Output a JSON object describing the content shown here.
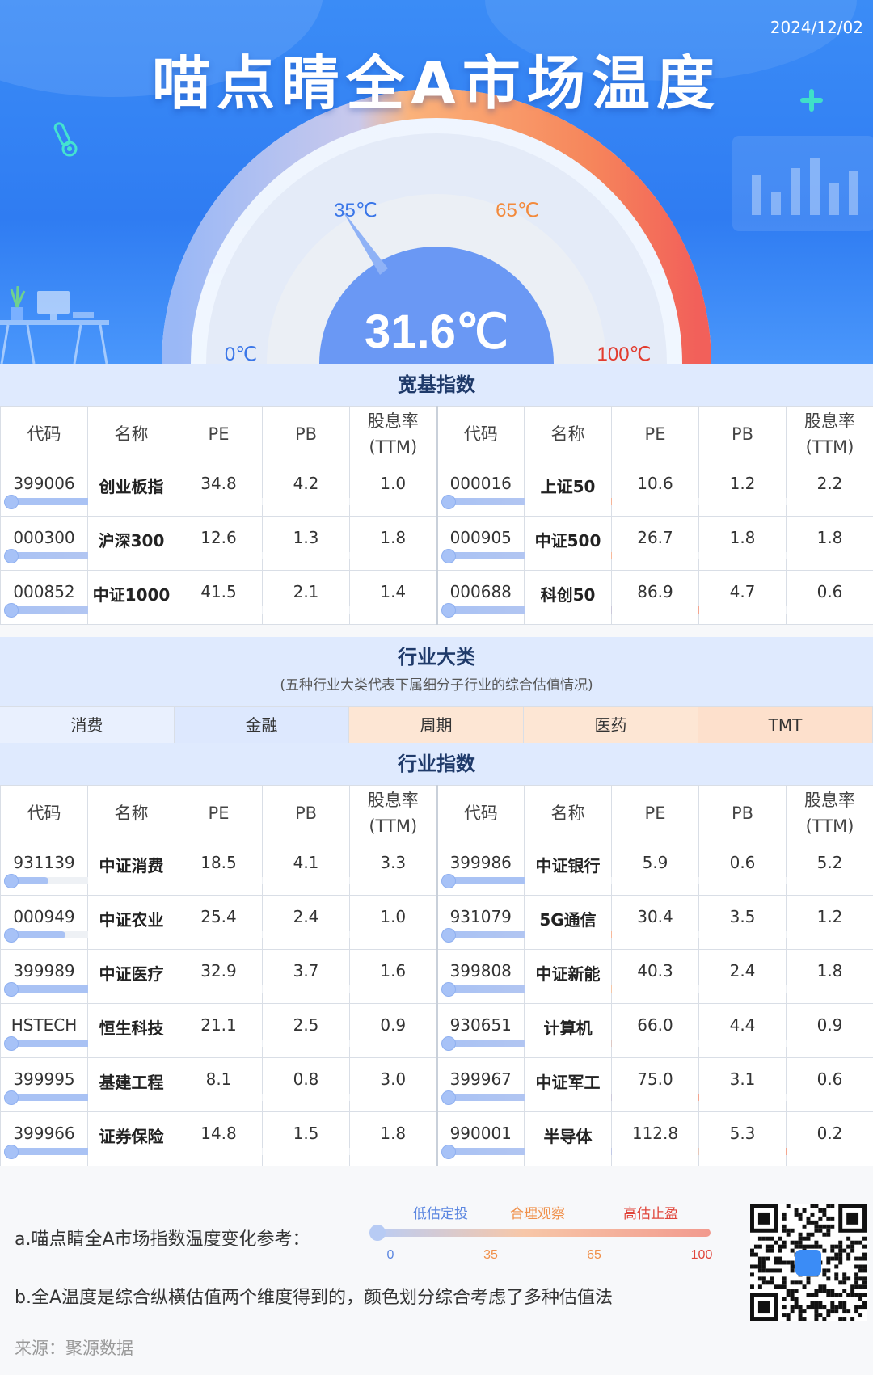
{
  "header": {
    "date": "2024/12/02",
    "title": "喵点睛全A市场温度",
    "temperature": "31.6℃",
    "temperature_value": 31.6,
    "scale_labels": {
      "zero": "0℃",
      "low": "35℃",
      "mid": "65℃",
      "high": "100℃"
    }
  },
  "broad": {
    "title": "宽基指数",
    "headers": [
      "代码",
      "名称",
      "PE",
      "PB",
      "股息率",
      "(TTM)"
    ],
    "rows": [
      [
        {
          "code": "399006",
          "name": "创业板指",
          "pe": "34.8",
          "pb": "4.2",
          "dy": "1.0",
          "level": 0.24
        },
        {
          "code": "000016",
          "name": "上证50",
          "pe": "10.6",
          "pb": "1.2",
          "dy": "2.2",
          "level": 0.43
        }
      ],
      [
        {
          "code": "000300",
          "name": "沪深300",
          "pe": "12.6",
          "pb": "1.3",
          "dy": "1.8",
          "level": 0.39
        },
        {
          "code": "000905",
          "name": "中证500",
          "pe": "26.7",
          "pb": "1.8",
          "dy": "1.8",
          "level": 0.44
        }
      ],
      [
        {
          "code": "000852",
          "name": "中证1000",
          "pe": "41.5",
          "pb": "2.1",
          "dy": "1.4",
          "level": 0.42
        },
        {
          "code": "000688",
          "name": "科创50",
          "pe": "86.9",
          "pb": "4.7",
          "dy": "0.6",
          "level": 0.62
        }
      ]
    ]
  },
  "category": {
    "title": "行业大类",
    "subtitle": "(五种行业大类代表下属细分子行业的综合估值情况)",
    "items": [
      "消费",
      "金融",
      "周期",
      "医药",
      "TMT"
    ],
    "colors": [
      "#e9f0fe",
      "#dde8fe",
      "#fde6d4",
      "#fde6d4",
      "#fde0cc"
    ]
  },
  "industry": {
    "title": "行业指数",
    "headers": [
      "代码",
      "名称",
      "PE",
      "PB",
      "股息率",
      "(TTM)"
    ],
    "rows": [
      [
        {
          "code": "931139",
          "name": "中证消费",
          "pe": "18.5",
          "pb": "4.1",
          "dy": "3.3",
          "level": 0.1
        },
        {
          "code": "399986",
          "name": "中证银行",
          "pe": "5.9",
          "pb": "0.6",
          "dy": "5.2",
          "level": 0.28
        }
      ],
      [
        {
          "code": "000949",
          "name": "中证农业",
          "pe": "25.4",
          "pb": "2.4",
          "dy": "1.0",
          "level": 0.14
        },
        {
          "code": "931079",
          "name": "5G通信",
          "pe": "30.4",
          "pb": "3.5",
          "dy": "1.2",
          "level": 0.44
        }
      ],
      [
        {
          "code": "399989",
          "name": "中证医疗",
          "pe": "32.9",
          "pb": "3.7",
          "dy": "1.6",
          "level": 0.23
        },
        {
          "code": "399808",
          "name": "中证新能",
          "pe": "40.3",
          "pb": "2.4",
          "dy": "1.8",
          "level": 0.47
        }
      ],
      [
        {
          "code": "HSTECH",
          "name": "恒生科技",
          "pe": "21.1",
          "pb": "2.5",
          "dy": "0.9",
          "level": 0.25
        },
        {
          "code": "930651",
          "name": "计算机",
          "pe": "66.0",
          "pb": "4.4",
          "dy": "0.9",
          "level": 0.52
        }
      ],
      [
        {
          "code": "399995",
          "name": "基建工程",
          "pe": "8.1",
          "pb": "0.8",
          "dy": "3.0",
          "level": 0.26
        },
        {
          "code": "399967",
          "name": "中证军工",
          "pe": "75.0",
          "pb": "3.1",
          "dy": "0.6",
          "level": 0.62
        }
      ],
      [
        {
          "code": "399966",
          "name": "证券保险",
          "pe": "14.8",
          "pb": "1.5",
          "dy": "1.8",
          "level": 0.3
        },
        {
          "code": "990001",
          "name": "半导体",
          "pe": "112.8",
          "pb": "5.3",
          "dy": "0.2",
          "level": 0.83
        }
      ]
    ]
  },
  "footer": {
    "note_a": "a.喵点睛全A市场指数温度变化参考：",
    "note_b": "b.全A温度是综合纵横估值两个维度得到的，颜色划分综合考虑了多种估值法",
    "source": "来源：聚源数据",
    "legend": {
      "labels": [
        "低估定投",
        "合理观察",
        "高估止盈"
      ],
      "ticks": [
        "0",
        "35",
        "65",
        "100"
      ],
      "colors": [
        "#5b86e0",
        "#f0904a",
        "#e0453a"
      ]
    }
  }
}
